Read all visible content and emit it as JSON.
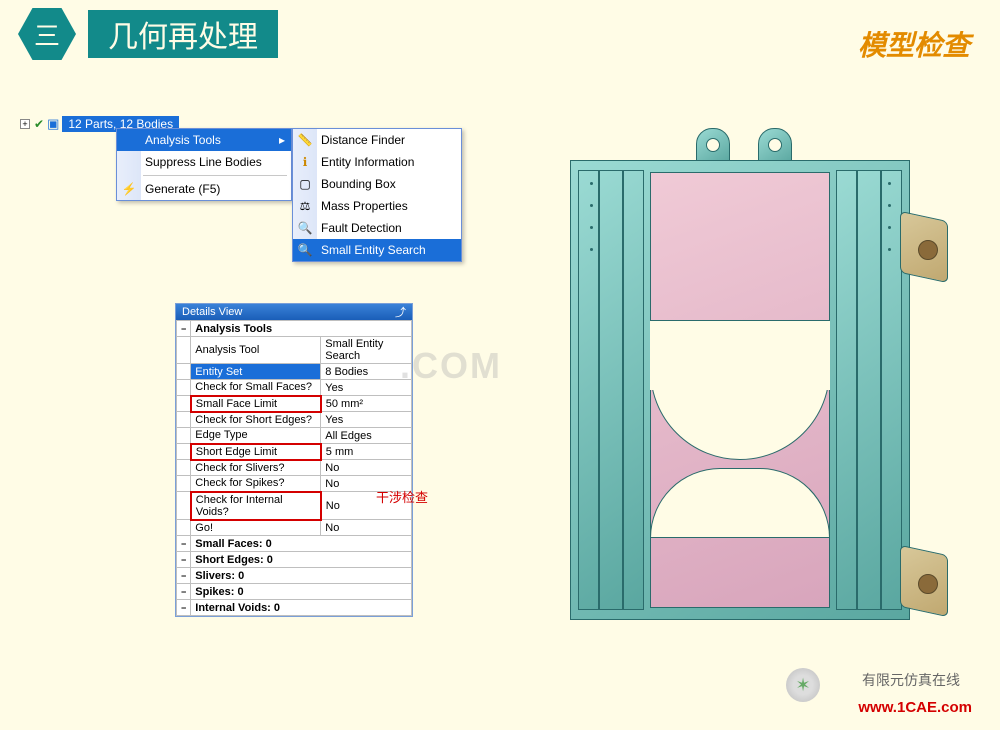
{
  "header": {
    "badge": "三",
    "title": "几何再处理",
    "right": "模型检查"
  },
  "tree_node": "12 Parts, 12 Bodies",
  "menu1": {
    "items": [
      {
        "label": "Analysis Tools",
        "selected": true,
        "submenu": true
      },
      {
        "label": "Suppress Line Bodies"
      }
    ],
    "generate": "Generate (F5)"
  },
  "menu2": {
    "items": [
      {
        "icon": "ruler",
        "label": "Distance Finder"
      },
      {
        "icon": "info",
        "label": "Entity Information"
      },
      {
        "icon": "box",
        "label": "Bounding Box"
      },
      {
        "icon": "mass",
        "label": "Mass Properties"
      },
      {
        "icon": "fault",
        "label": "Fault Detection"
      },
      {
        "icon": "search",
        "label": "Small Entity Search",
        "selected": true
      }
    ]
  },
  "details": {
    "title": "Details View",
    "section": "Analysis Tools",
    "rows": [
      {
        "k": "Analysis Tool",
        "v": "Small Entity Search"
      },
      {
        "k": "Entity Set",
        "v": "8 Bodies",
        "sel": true
      },
      {
        "k": "Check for Small Faces?",
        "v": "Yes"
      },
      {
        "k": "Small Face Limit",
        "v": "50 mm²",
        "red": true
      },
      {
        "k": "Check for Short Edges?",
        "v": "Yes"
      },
      {
        "k": "Edge Type",
        "v": "All Edges"
      },
      {
        "k": "Short Edge Limit",
        "v": "5 mm",
        "red": true
      },
      {
        "k": "Check for Slivers?",
        "v": "No"
      },
      {
        "k": "Check for Spikes?",
        "v": "No"
      },
      {
        "k": "Check for Internal Voids?",
        "v": "No",
        "red": true,
        "ann": "干涉检查"
      },
      {
        "k": "Go!",
        "v": "No"
      }
    ],
    "summary": [
      "Small Faces: 0",
      "Short Edges: 0",
      "Slivers: 0",
      "Spikes: 0",
      "Internal Voids: 0"
    ]
  },
  "watermark": ".COM",
  "footer": {
    "cn": "有限元仿真在线",
    "url": "www.1CAE.com"
  }
}
